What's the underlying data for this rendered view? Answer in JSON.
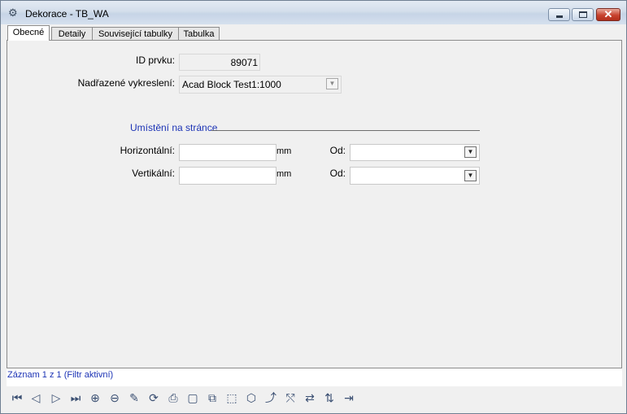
{
  "window": {
    "title": "Dekorace - TB_WA",
    "app_icon": "network-node-icon",
    "controls": {
      "minimize_icon": "minimize-icon",
      "maximize_icon": "maximize-icon",
      "close_icon": "close-icon",
      "close_glyph": "✕"
    }
  },
  "tabs": [
    {
      "label": "Obecné",
      "active": true
    },
    {
      "label": "Detaily",
      "active": false
    },
    {
      "label": "Související tabulky",
      "active": false
    },
    {
      "label": "Tabulka",
      "active": false
    }
  ],
  "form": {
    "id_label": "ID prvku:",
    "id_value": "89071",
    "parent_label": "Nadřazené vykreslení:",
    "parent_value": "Acad Block Test1:1000",
    "section_title": "Umístění na stránce",
    "horizontal_label": "Horizontální:",
    "horizontal_value": "",
    "horizontal_unit": "mm",
    "horizontal_from_label": "Od:",
    "horizontal_from_value": "",
    "vertical_label": "Vertikální:",
    "vertical_value": "",
    "vertical_unit": "mm",
    "vertical_from_label": "Od:",
    "vertical_from_value": ""
  },
  "status": {
    "text": "Záznam 1 z 1 (Filtr aktivní)"
  },
  "toolbar": {
    "buttons": [
      {
        "name": "first-record-icon",
        "glyph": "⏮"
      },
      {
        "name": "previous-record-icon",
        "glyph": "◁"
      },
      {
        "name": "next-record-icon",
        "glyph": "▷"
      },
      {
        "name": "last-record-icon",
        "glyph": "⏭"
      },
      {
        "name": "add-filter-icon",
        "glyph": "⊕"
      },
      {
        "name": "remove-filter-icon",
        "glyph": "⊖"
      },
      {
        "name": "edit-pencil-icon",
        "glyph": "✎"
      },
      {
        "name": "refresh-icon",
        "glyph": "⟳"
      },
      {
        "name": "print-icon",
        "glyph": "⎙"
      },
      {
        "name": "select-object-icon",
        "glyph": "▢"
      },
      {
        "name": "select-multiple-icon",
        "glyph": "⧉"
      },
      {
        "name": "zoom-extent-icon",
        "glyph": "⬚"
      },
      {
        "name": "zoom-window-icon",
        "glyph": "⬡"
      },
      {
        "name": "connect-icon",
        "glyph": "⤴"
      },
      {
        "name": "network-trace-icon",
        "glyph": "⤲"
      },
      {
        "name": "move-arrows-icon",
        "glyph": "⇄"
      },
      {
        "name": "properties-icon",
        "glyph": "⇅"
      },
      {
        "name": "exit-icon",
        "glyph": "⇥"
      }
    ]
  }
}
